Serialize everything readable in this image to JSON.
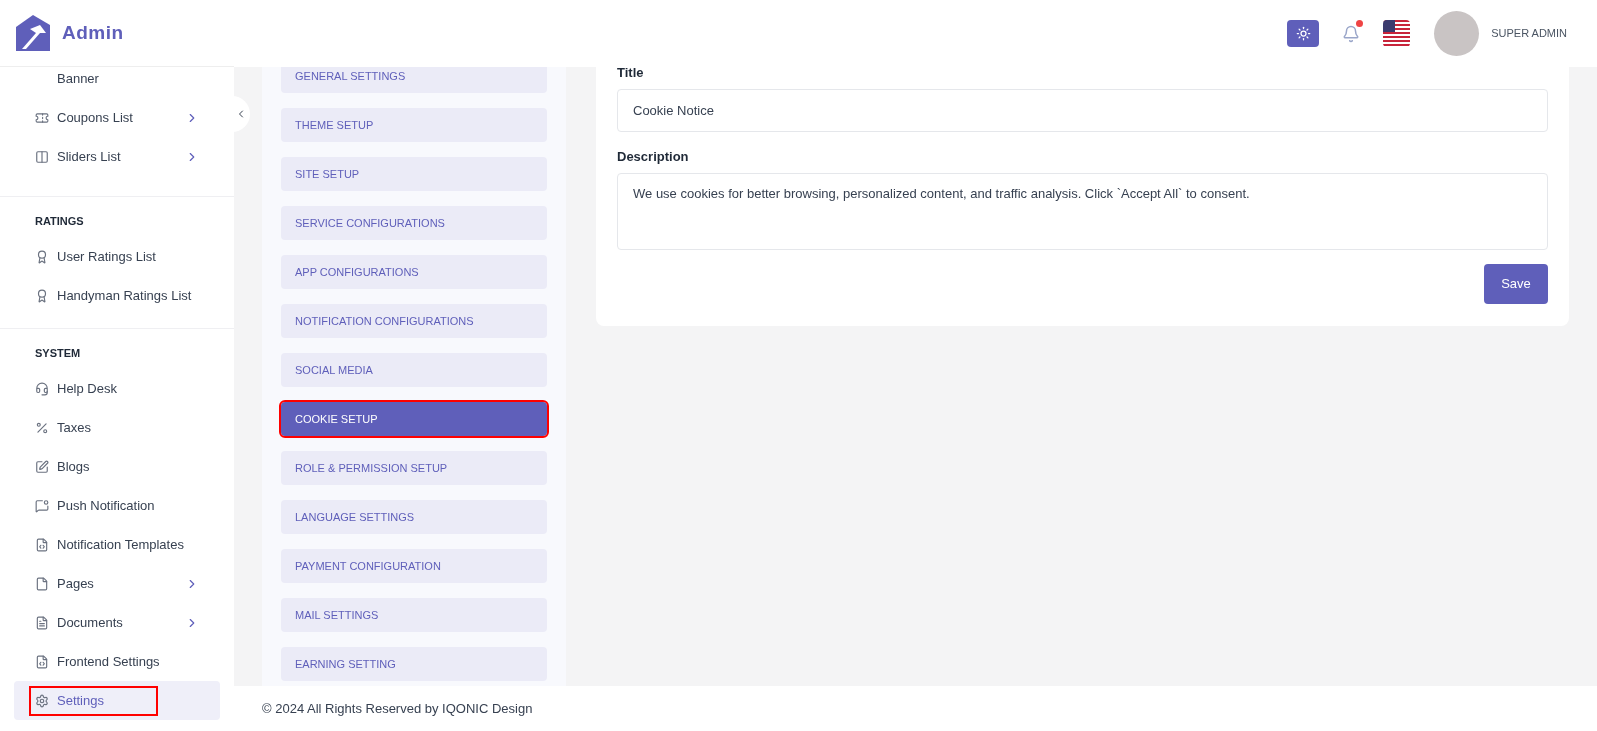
{
  "brand": {
    "name": "Admin"
  },
  "sidebar": {
    "sections": [
      {
        "items": [
          {
            "label": "Banner",
            "has_submenu": false,
            "selected": false,
            "highlighted": false
          },
          {
            "label": "Coupons List",
            "has_submenu": true,
            "selected": false,
            "highlighted": false
          },
          {
            "label": "Sliders List",
            "has_submenu": true,
            "selected": false,
            "highlighted": false
          }
        ]
      },
      {
        "heading": "RATINGS",
        "items": [
          {
            "label": "User Ratings List",
            "has_submenu": false,
            "selected": false,
            "highlighted": false
          },
          {
            "label": "Handyman Ratings List",
            "has_submenu": false,
            "selected": false,
            "highlighted": false
          }
        ]
      },
      {
        "heading": "SYSTEM",
        "items": [
          {
            "label": "Help Desk",
            "has_submenu": false,
            "selected": false,
            "highlighted": false
          },
          {
            "label": "Taxes",
            "has_submenu": false,
            "selected": false,
            "highlighted": false
          },
          {
            "label": "Blogs",
            "has_submenu": false,
            "selected": false,
            "highlighted": false
          },
          {
            "label": "Push Notification",
            "has_submenu": false,
            "selected": false,
            "highlighted": false
          },
          {
            "label": "Notification Templates",
            "has_submenu": false,
            "selected": false,
            "highlighted": false
          },
          {
            "label": "Pages",
            "has_submenu": true,
            "selected": false,
            "highlighted": false
          },
          {
            "label": "Documents",
            "has_submenu": true,
            "selected": false,
            "highlighted": false
          },
          {
            "label": "Frontend Settings",
            "has_submenu": false,
            "selected": false,
            "highlighted": false
          },
          {
            "label": "Settings",
            "has_submenu": false,
            "selected": true,
            "highlighted": true
          }
        ]
      }
    ]
  },
  "header": {
    "user_name": "SUPER ADMIN",
    "notification_dot": true
  },
  "settings_menu": [
    {
      "label": "GENERAL SETTINGS",
      "selected": false,
      "highlighted": false
    },
    {
      "label": "THEME SETUP",
      "selected": false,
      "highlighted": false
    },
    {
      "label": "SITE SETUP",
      "selected": false,
      "highlighted": false
    },
    {
      "label": "SERVICE CONFIGURATIONS",
      "selected": false,
      "highlighted": false
    },
    {
      "label": "APP CONFIGURATIONS",
      "selected": false,
      "highlighted": false
    },
    {
      "label": "NOTIFICATION CONFIGURATIONS",
      "selected": false,
      "highlighted": false
    },
    {
      "label": "SOCIAL MEDIA",
      "selected": false,
      "highlighted": false
    },
    {
      "label": "COOKIE SETUP",
      "selected": true,
      "highlighted": true
    },
    {
      "label": "ROLE & PERMISSION SETUP",
      "selected": false,
      "highlighted": false
    },
    {
      "label": "LANGUAGE SETTINGS",
      "selected": false,
      "highlighted": false
    },
    {
      "label": "PAYMENT CONFIGURATION",
      "selected": false,
      "highlighted": false
    },
    {
      "label": "MAIL SETTINGS",
      "selected": false,
      "highlighted": false
    },
    {
      "label": "EARNING SETTING",
      "selected": false,
      "highlighted": false
    }
  ],
  "form": {
    "title_label": "Title",
    "title_value": "Cookie Notice",
    "description_label": "Description",
    "description_value": "We use cookies for better browsing, personalized content, and traffic analysis. Click `Accept All` to consent.",
    "save_button": "Save"
  },
  "footer": {
    "text": "© 2024 All Rights Reserved by IQONIC Design"
  }
}
